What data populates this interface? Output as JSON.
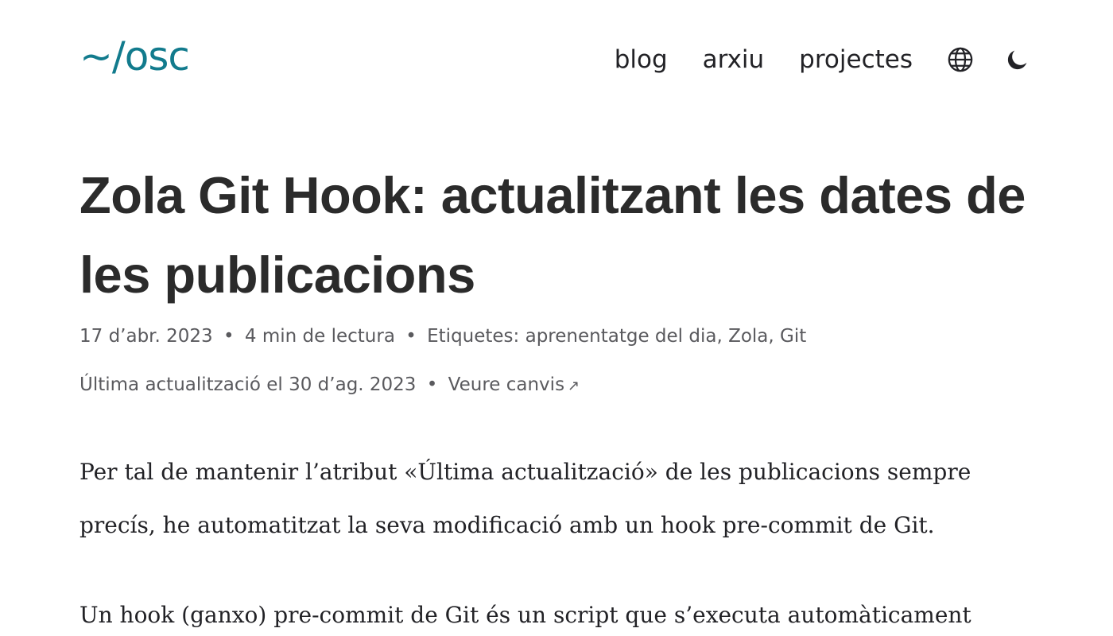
{
  "header": {
    "logo": "~/osc",
    "nav": {
      "blog": "blog",
      "archive": "arxiu",
      "projects": "projectes"
    },
    "icons": {
      "language": "globe-icon",
      "theme": "moon-icon"
    }
  },
  "article": {
    "title": "Zola Git Hook: actualitzant les dates de les publicacions",
    "date": "17 d’abr. 2023",
    "reading_time": "4 min de lectura",
    "tags_label": "Etiquetes:",
    "tags": [
      "aprenentatge del dia",
      "Zola",
      "Git"
    ],
    "updated": "Última actualització el 30 d’ag. 2023",
    "changes_link": "Veure canvis",
    "changes_arrow": "↗",
    "separator": "•",
    "comma": ",",
    "paragraphs": [
      "Per tal de mantenir l’atribut «Última actualització» de les publicacions sempre precís, he automatitzat la seva modificació amb un hook pre-commit de Git.",
      "Un hook (ganxo) pre-commit de Git és un script que s’executa automàticament"
    ]
  },
  "colors": {
    "accent": "#127b8d",
    "text": "#222226",
    "meta": "#5a5a5e"
  }
}
